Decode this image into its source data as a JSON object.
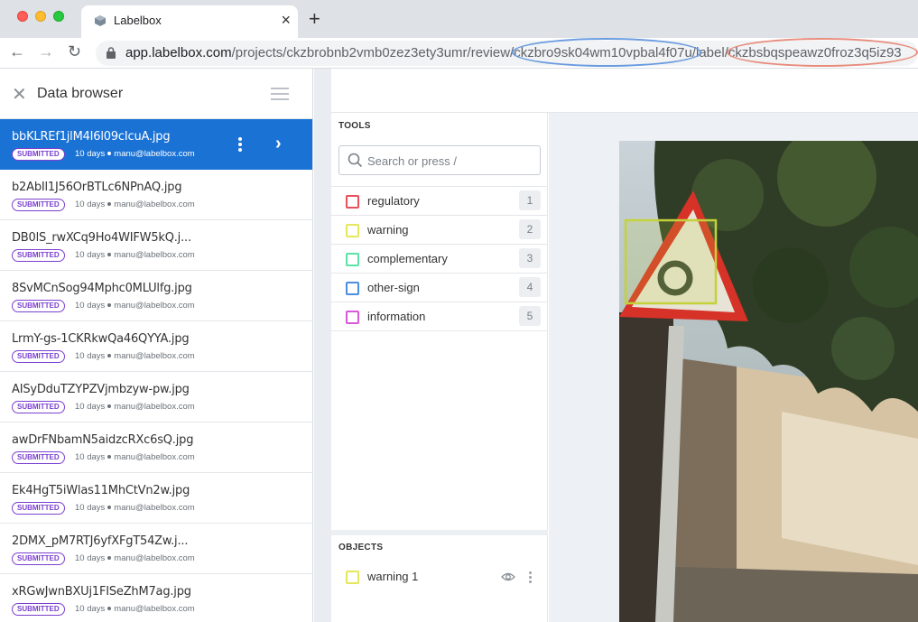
{
  "browser": {
    "tab_title": "Labelbox",
    "url_host": "app.labelbox.com",
    "url_path_prefix": "/projects/ckzbrobnb2vmb0zez3ety3umr/review/",
    "url_data_row_id": "ckzbro9sk04wm10vpbal4f07u",
    "url_label_segment": "/label/",
    "url_label_id": "ckzbsbqspeawz0froz3q5iz93"
  },
  "sidebar": {
    "title": "Data browser",
    "rows": [
      {
        "name": "bbKLREf1jlM4I6l09cIcuA.jpg",
        "status": "SUBMITTED",
        "age": "10 days",
        "user": "manu@labelbox.com"
      },
      {
        "name": "b2AbIl1J56OrBTLc6NPnAQ.jpg",
        "status": "SUBMITTED",
        "age": "10 days",
        "user": "manu@labelbox.com"
      },
      {
        "name": "DB0lS_rwXCq9Ho4WIFW5kQ.j...",
        "status": "SUBMITTED",
        "age": "10 days",
        "user": "manu@labelbox.com"
      },
      {
        "name": "8SvMCnSog94Mphc0MLUlfg.jpg",
        "status": "SUBMITTED",
        "age": "10 days",
        "user": "manu@labelbox.com"
      },
      {
        "name": "LrmY-gs-1CKRkwQa46QYYA.jpg",
        "status": "SUBMITTED",
        "age": "10 days",
        "user": "manu@labelbox.com"
      },
      {
        "name": "AISyDduTZYPZVjmbzyw-pw.jpg",
        "status": "SUBMITTED",
        "age": "10 days",
        "user": "manu@labelbox.com"
      },
      {
        "name": "awDrFNbamN5aidzcRXc6sQ.jpg",
        "status": "SUBMITTED",
        "age": "10 days",
        "user": "manu@labelbox.com"
      },
      {
        "name": "Ek4HgT5iWlas11MhCtVn2w.jpg",
        "status": "SUBMITTED",
        "age": "10 days",
        "user": "manu@labelbox.com"
      },
      {
        "name": "2DMX_pM7RTJ6yfXFgT54Zw.j...",
        "status": "SUBMITTED",
        "age": "10 days",
        "user": "manu@labelbox.com"
      },
      {
        "name": "xRGwJwnBXUj1FISeZhM7ag.jpg",
        "status": "SUBMITTED",
        "age": "10 days",
        "user": "manu@labelbox.com"
      }
    ]
  },
  "tools": {
    "title": "TOOLS",
    "search_placeholder": "Search or press /",
    "items": [
      {
        "label": "regulatory",
        "hotkey": "1",
        "color": "#e8505b"
      },
      {
        "label": "warning",
        "hotkey": "2",
        "color": "#e4e85a"
      },
      {
        "label": "complementary",
        "hotkey": "3",
        "color": "#5be3a6"
      },
      {
        "label": "other-sign",
        "hotkey": "4",
        "color": "#4a8fe0"
      },
      {
        "label": "information",
        "hotkey": "5",
        "color": "#d65ad9"
      }
    ]
  },
  "objects": {
    "title": "OBJECTS",
    "items": [
      {
        "label": "warning 1",
        "color": "#e4e85a"
      }
    ]
  },
  "colors": {
    "selection": "#1a72d5",
    "badge": "#7b3fd0",
    "annotation_box": "#c4d23a"
  }
}
